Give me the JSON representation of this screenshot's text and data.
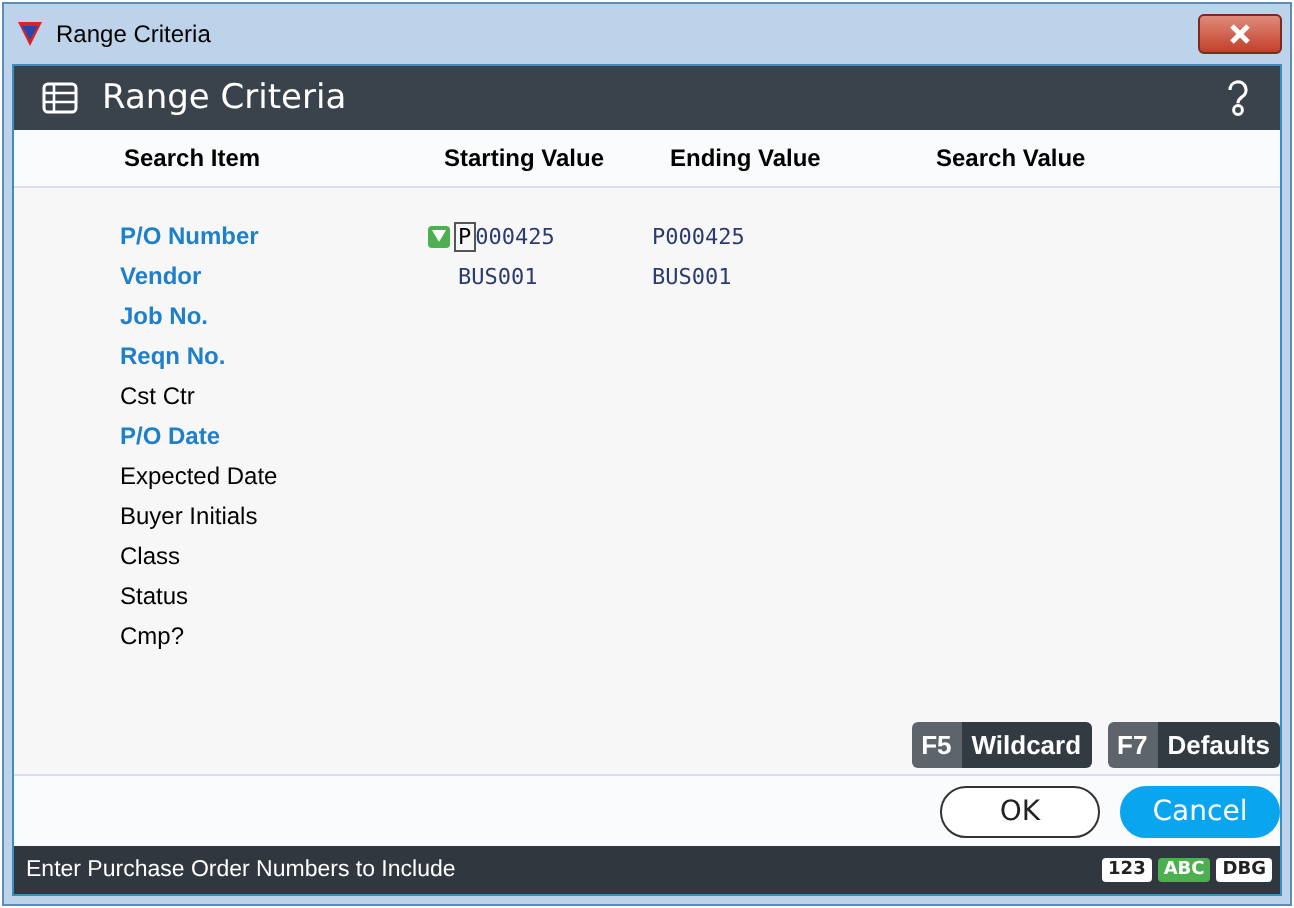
{
  "window": {
    "title": "Range Criteria"
  },
  "header": {
    "title": "Range Criteria"
  },
  "columns": [
    "Search Item",
    "Starting Value",
    "Ending Value",
    "Search Value"
  ],
  "rows": [
    {
      "item": "P/O Number",
      "kind": "key",
      "start": "P000425",
      "end": "P000425",
      "focused": true
    },
    {
      "item": "Vendor",
      "kind": "key",
      "start": "BUS001",
      "end": "BUS001"
    },
    {
      "item": "Job No.",
      "kind": "key"
    },
    {
      "item": "Reqn No.",
      "kind": "key"
    },
    {
      "item": "Cst Ctr",
      "kind": "plain"
    },
    {
      "item": "P/O Date",
      "kind": "key"
    },
    {
      "item": "Expected Date",
      "kind": "plain"
    },
    {
      "item": "Buyer Initials",
      "kind": "plain"
    },
    {
      "item": "Class",
      "kind": "plain"
    },
    {
      "item": "Status",
      "kind": "plain"
    },
    {
      "item": "Cmp?",
      "kind": "plain"
    }
  ],
  "function_keys": [
    {
      "key": "F5",
      "label": "Wildcard"
    },
    {
      "key": "F7",
      "label": "Defaults"
    }
  ],
  "buttons": [
    {
      "label": "OK",
      "kind": "secondary"
    },
    {
      "label": "Cancel",
      "kind": "primary"
    }
  ],
  "status_bar": {
    "message": "Enter Purchase Order Numbers to Include",
    "modes": [
      {
        "label": "123",
        "selected": false
      },
      {
        "label": "ABC",
        "selected": true
      },
      {
        "label": "DBG",
        "selected": false
      }
    ]
  }
}
